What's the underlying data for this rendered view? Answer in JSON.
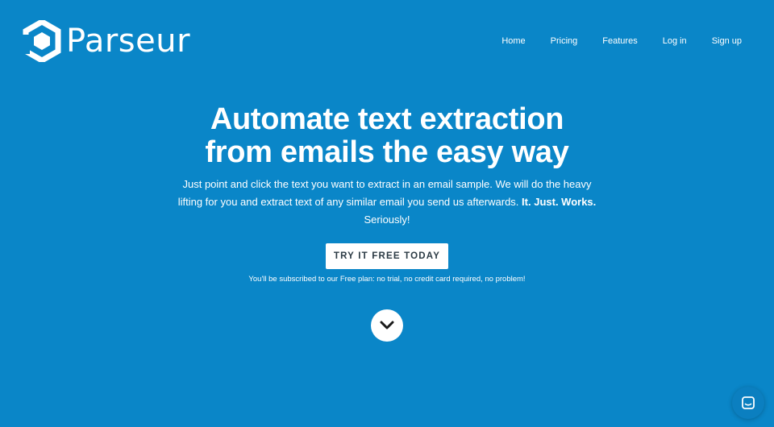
{
  "brand": {
    "name": "Parseur",
    "logo_icon": "hexagon-p-logo-icon"
  },
  "nav": {
    "items": [
      {
        "label": "Home"
      },
      {
        "label": "Pricing"
      },
      {
        "label": "Features"
      },
      {
        "label": "Log in"
      },
      {
        "label": "Sign up"
      }
    ]
  },
  "hero": {
    "headline_line1": "Automate text extraction",
    "headline_line2": "from emails the easy way",
    "subtext_part1": "Just point and click the text you want to extract in an email sample. We will do the heavy lifting for you and extract text of any similar email you send us afterwards.",
    "subtext_emphasis": "It. Just. Works.",
    "subtext_part2": "Seriously!",
    "cta_label": "TRY IT FREE TODAY",
    "cta_note": "You'll be subscribed to our Free plan: no trial, no credit card required, no problem!"
  },
  "icons": {
    "scroll_down": "chevron-down-icon",
    "chat": "chat-icon"
  },
  "colors": {
    "background": "#0a86c8",
    "text": "#ffffff",
    "button_bg": "#ffffff",
    "button_text": "#2b3a44"
  }
}
